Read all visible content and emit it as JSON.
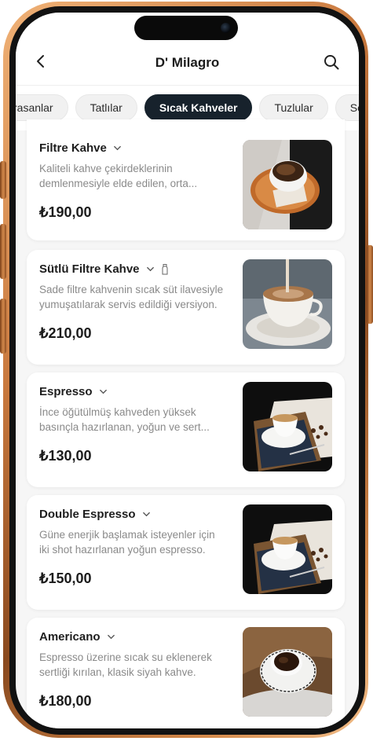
{
  "header": {
    "title": "D' Milagro"
  },
  "tabs": [
    {
      "label": "rasanlar",
      "active": false
    },
    {
      "label": "Tatlılar",
      "active": false
    },
    {
      "label": "Sıcak Kahveler",
      "active": true
    },
    {
      "label": "Tuzlular",
      "active": false
    },
    {
      "label": "Soğuk",
      "active": false
    }
  ],
  "products": [
    {
      "name": "Filtre Kahve",
      "description": "Kaliteli kahve çekirdeklerinin demlenmesiyle elde edilen, orta...",
      "price": "₺190,00",
      "image": "filter-coffee-photo"
    },
    {
      "name": "Sütlü Filtre Kahve",
      "description": "Sade filtre kahvenin sıcak süt ilavesiyle yumuşatılarak servis edildiği versiyon.",
      "price": "₺210,00",
      "image": "milk-filter-coffee-photo",
      "badge_icon": "milk-bottle-icon"
    },
    {
      "name": "Espresso",
      "description": "İnce öğütülmüş kahveden yüksek basınçla hazırlanan, yoğun ve sert...",
      "price": "₺130,00",
      "image": "espresso-photo"
    },
    {
      "name": "Double Espresso",
      "description": "Güne enerjik başlamak isteyenler için iki shot hazırlanan yoğun espresso.",
      "price": "₺150,00",
      "image": "double-espresso-photo"
    },
    {
      "name": "Americano",
      "description": "Espresso üzerine sıcak su eklenerek sertliği kırılan, klasik siyah kahve.",
      "price": "₺180,00",
      "image": "americano-photo"
    }
  ],
  "colors": {
    "active_tab": "#17222c",
    "frame": "#c9793e",
    "text_primary": "#1b1b1b",
    "text_muted": "#8a8a8a"
  }
}
